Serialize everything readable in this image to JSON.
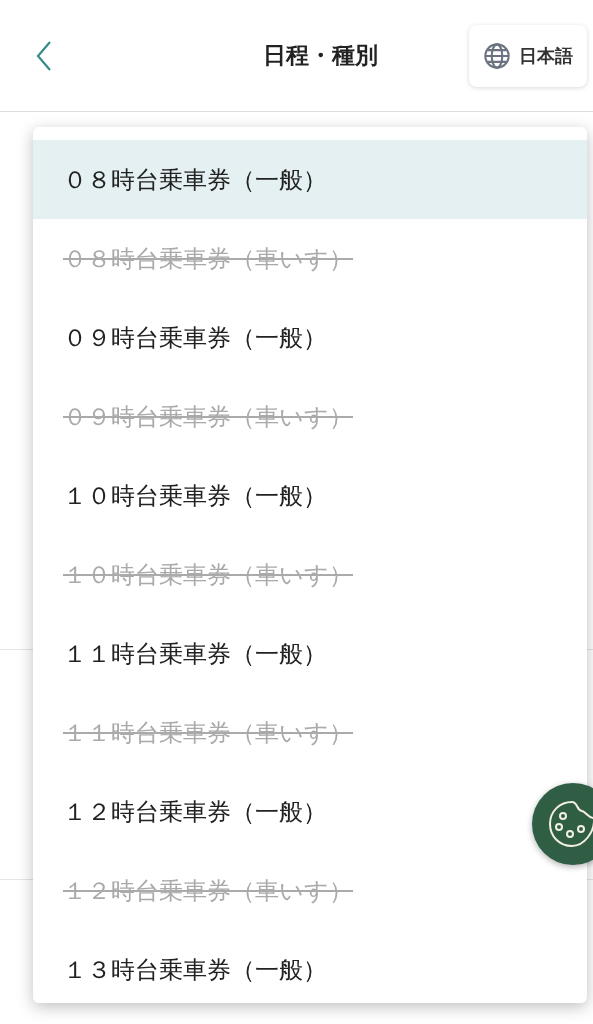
{
  "header": {
    "title": "日程・種別",
    "language_button": "日本語"
  },
  "dropdown": {
    "options": [
      {
        "label": "０８時台乗車券（一般）",
        "disabled": false,
        "selected": true
      },
      {
        "label": "０８時台乗車券（車いす）",
        "disabled": true,
        "selected": false
      },
      {
        "label": "０９時台乗車券（一般）",
        "disabled": false,
        "selected": false
      },
      {
        "label": "０９時台乗車券（車いす）",
        "disabled": true,
        "selected": false
      },
      {
        "label": "１０時台乗車券（一般）",
        "disabled": false,
        "selected": false
      },
      {
        "label": "１０時台乗車券（車いす）",
        "disabled": true,
        "selected": false
      },
      {
        "label": "１１時台乗車券（一般）",
        "disabled": false,
        "selected": false
      },
      {
        "label": "１１時台乗車券（車いす）",
        "disabled": true,
        "selected": false
      },
      {
        "label": "１２時台乗車券（一般）",
        "disabled": false,
        "selected": false
      },
      {
        "label": "１２時台乗車券（車いす）",
        "disabled": true,
        "selected": false
      },
      {
        "label": "１３時台乗車券（一般）",
        "disabled": false,
        "selected": false
      }
    ]
  }
}
